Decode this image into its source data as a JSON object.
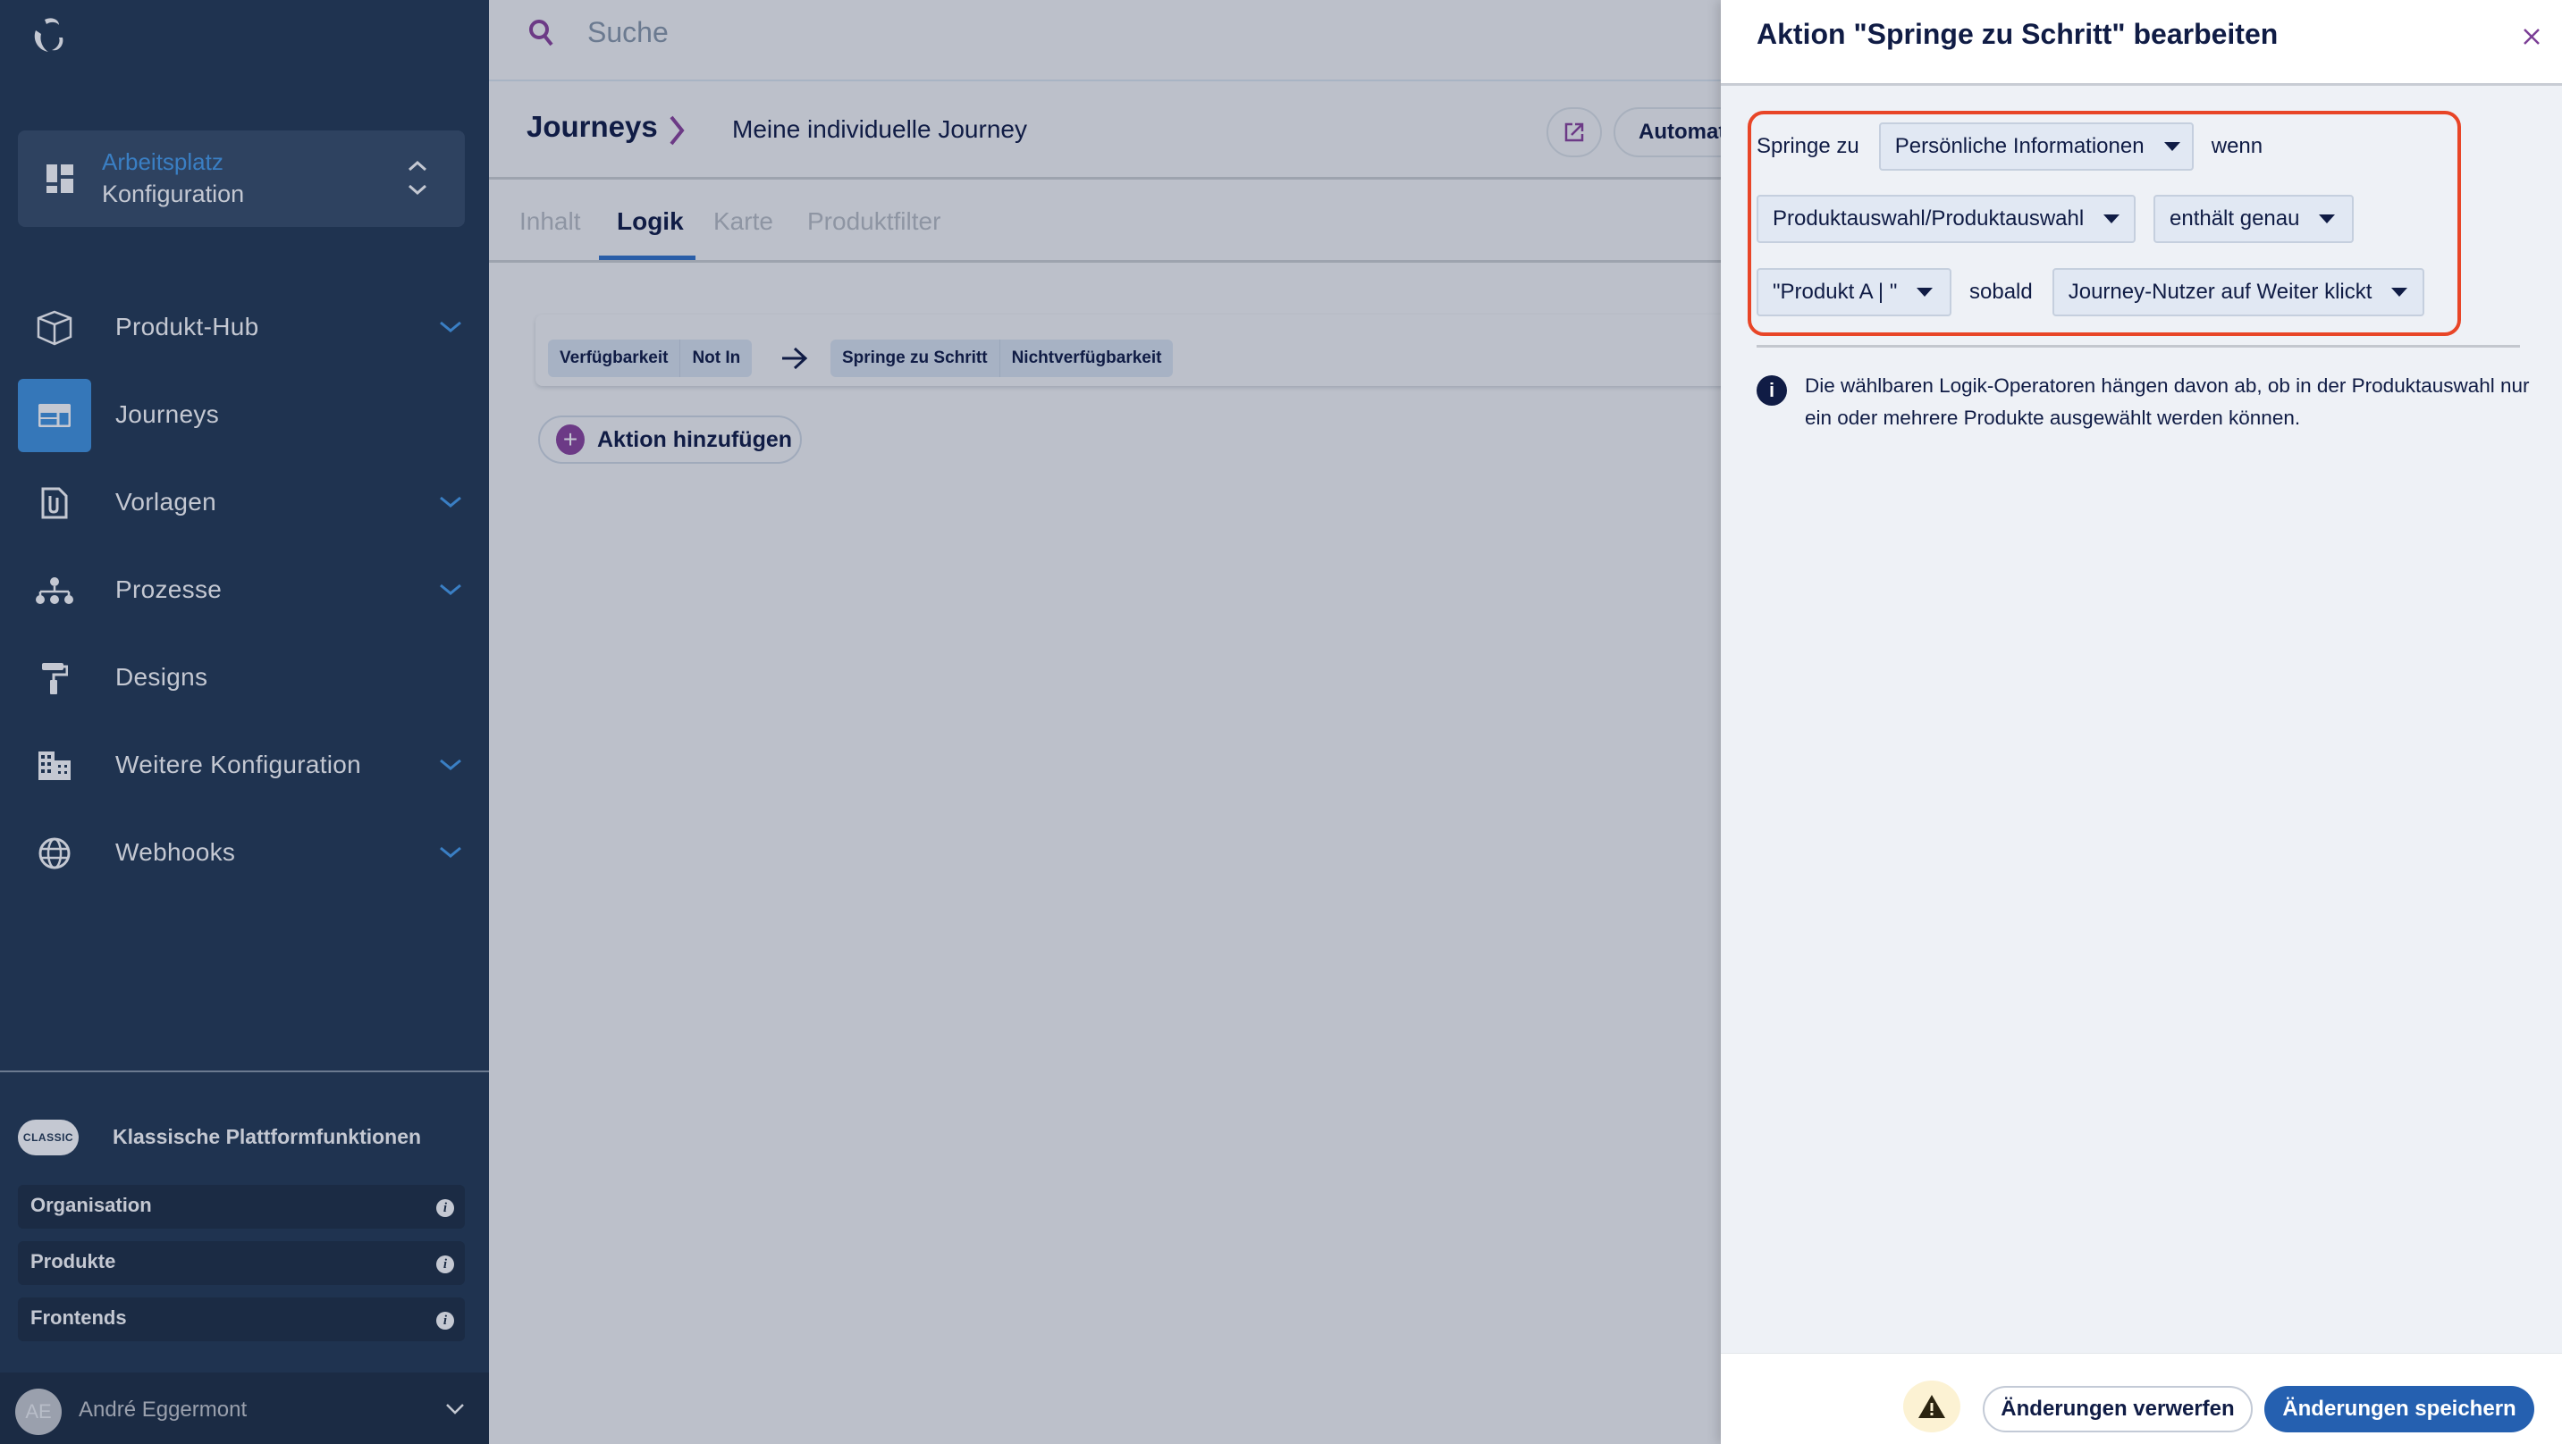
{
  "sidebar": {
    "logo": "brand-logo",
    "workspace": {
      "title": "Arbeitsplatz",
      "subtitle": "Konfiguration"
    },
    "nav": [
      {
        "label": "Produkt-Hub",
        "icon": "cube-icon",
        "expandable": true,
        "active": false
      },
      {
        "label": "Journeys",
        "icon": "journey-layout-icon",
        "expandable": false,
        "active": true
      },
      {
        "label": "Vorlagen",
        "icon": "document-clip-icon",
        "expandable": true,
        "active": false
      },
      {
        "label": "Prozesse",
        "icon": "hierarchy-icon",
        "expandable": true,
        "active": false
      },
      {
        "label": "Designs",
        "icon": "paint-roller-icon",
        "expandable": false,
        "active": false
      },
      {
        "label": "Weitere Konfiguration",
        "icon": "building-icon",
        "expandable": true,
        "active": false
      },
      {
        "label": "Webhooks",
        "icon": "globe-icon",
        "expandable": true,
        "active": false
      }
    ],
    "classic": {
      "badge": "CLASSIC",
      "title": "Klassische Plattformfunktionen",
      "items": [
        {
          "label": "Organisation"
        },
        {
          "label": "Produkte"
        },
        {
          "label": "Frontends"
        }
      ]
    },
    "user": {
      "initials": "AE",
      "name": "André Eggermont"
    }
  },
  "main": {
    "search": {
      "placeholder": "Suche",
      "value": ""
    },
    "breadcrumb": {
      "root": "Journeys",
      "current": "Meine individuelle Journey"
    },
    "header_buttons": {
      "automation_label": "Automat"
    },
    "tabs": [
      {
        "label": "Inhalt",
        "active": false
      },
      {
        "label": "Logik",
        "active": true
      },
      {
        "label": "Karte",
        "active": false
      },
      {
        "label": "Produktfilter",
        "active": false
      }
    ],
    "rule": {
      "condition": [
        "Verfügbarkeit",
        "Not In"
      ],
      "action": [
        "Springe zu Schritt",
        "Nichtverfügbarkeit"
      ]
    },
    "add_action_label": "Aktion hinzufügen"
  },
  "drawer": {
    "title": "Aktion \"Springe zu Schritt\" bearbeiten",
    "form": {
      "jump_to_label": "Springe zu",
      "target_step": "Persönliche Informationen",
      "if_label": "wenn",
      "field": "Produktauswahl/Produktauswahl",
      "operator": "enthält genau",
      "value": "\"Produkt A | \"",
      "when_label": "sobald",
      "trigger": "Journey-Nutzer auf Weiter klickt"
    },
    "info_text": "Die wählbaren Logik-Operatoren hängen davon ab, ob in der Produktauswahl nur ein oder mehrere Produkte ausgewählt werden können.",
    "footer": {
      "discard_label": "Änderungen verwerfen",
      "save_label": "Änderungen speichern"
    }
  },
  "colors": {
    "sidebar_bg": "#1f3350",
    "accent_blue": "#3577b9",
    "primary_button": "#2560b0",
    "highlight_border": "#e84527",
    "brand_purple": "#6c3a86",
    "text_dark": "#101c45"
  }
}
